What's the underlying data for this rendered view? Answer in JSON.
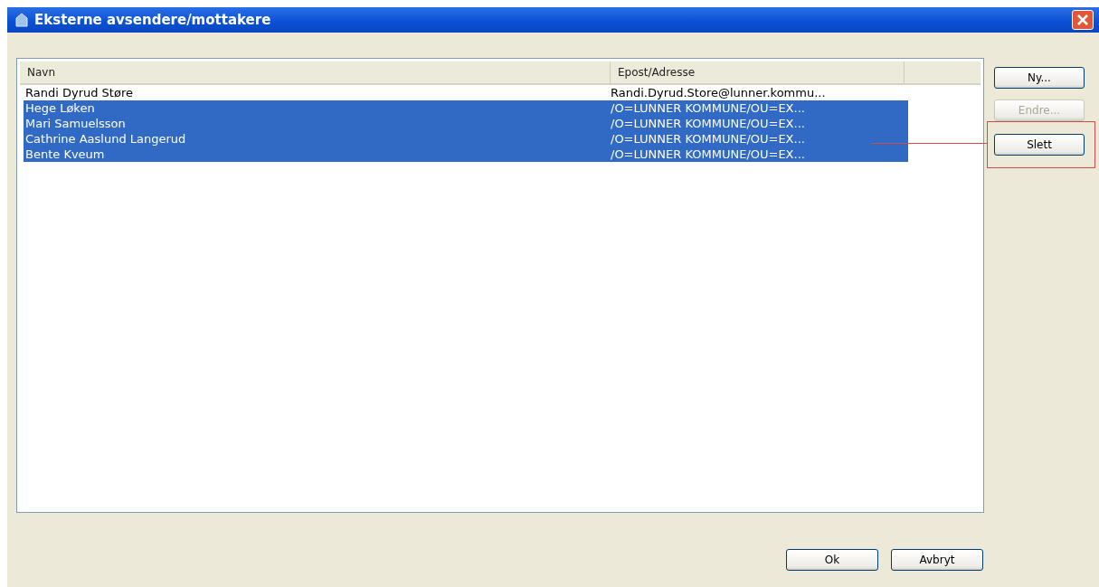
{
  "window": {
    "title": "Eksterne avsendere/mottakere"
  },
  "table": {
    "columns": [
      "Navn",
      "Epost/Adresse"
    ],
    "rows": [
      {
        "name": "Randi Dyrud Støre",
        "address": "Randi.Dyrud.Store@lunner.kommu...",
        "selected": false
      },
      {
        "name": "Hege Løken",
        "address": "/O=LUNNER KOMMUNE/OU=EX...",
        "selected": true
      },
      {
        "name": "Mari Samuelsson",
        "address": "/O=LUNNER KOMMUNE/OU=EX...",
        "selected": true
      },
      {
        "name": "Cathrine Aaslund Langerud",
        "address": "/O=LUNNER KOMMUNE/OU=EX...",
        "selected": true
      },
      {
        "name": "Bente Kveum",
        "address": "/O=LUNNER KOMMUNE/OU=EX...",
        "selected": true
      }
    ]
  },
  "side_buttons": [
    {
      "label": "Ny...",
      "disabled": false,
      "highlighted": false
    },
    {
      "label": "Endre...",
      "disabled": true,
      "highlighted": false
    },
    {
      "label": "Slett",
      "disabled": false,
      "highlighted": true
    }
  ],
  "footer_buttons": [
    "Ok",
    "Avbryt"
  ]
}
